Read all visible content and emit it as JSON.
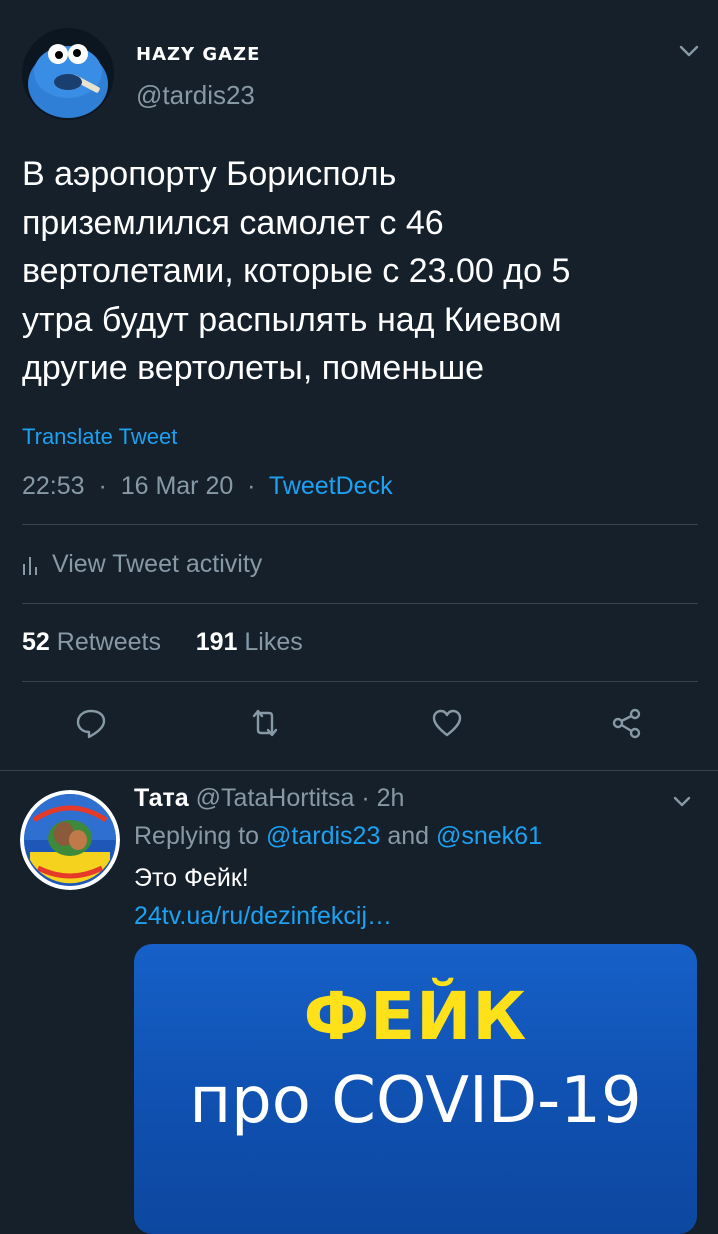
{
  "main_tweet": {
    "display_name": "HAZY GAZE",
    "handle": "@tardis23",
    "text_lines": [
      "В аэропорту Борисполь",
      "приземлился самолет с 46",
      "вертолетами, которые с 23.00 до 5",
      "утра будут распылять над Киевом",
      "другие вертолеты, поменьше"
    ],
    "translate_label": "Translate Tweet",
    "time": "22:53",
    "date": "16 Mar 20",
    "client": "TweetDeck",
    "activity_label": "View Tweet activity",
    "retweets_count": "52",
    "retweets_label": "Retweets",
    "likes_count": "191",
    "likes_label": "Likes"
  },
  "reply": {
    "name": "Тата",
    "handle": "@TataHortitsa",
    "time": "2h",
    "replying_prefix": "Replying to",
    "mention_1": "@tardis23",
    "and_word": "and",
    "mention_2": "@snek61",
    "text": "Это Фейк!",
    "link": "24tv.ua/ru/dezinfekcij…",
    "card_line1": "ФЕЙК",
    "card_line2": "про COVID-19"
  },
  "icons": {
    "chevron": "chevron-down-icon",
    "activity": "bar-chart-icon",
    "reply": "reply-icon",
    "retweet": "retweet-icon",
    "like": "heart-icon",
    "share": "share-icon"
  },
  "colors": {
    "background": "#15202b",
    "accent": "#1da1f2",
    "muted": "#8899a6",
    "divider": "#38444d",
    "card_yellow": "#ffe11a"
  }
}
